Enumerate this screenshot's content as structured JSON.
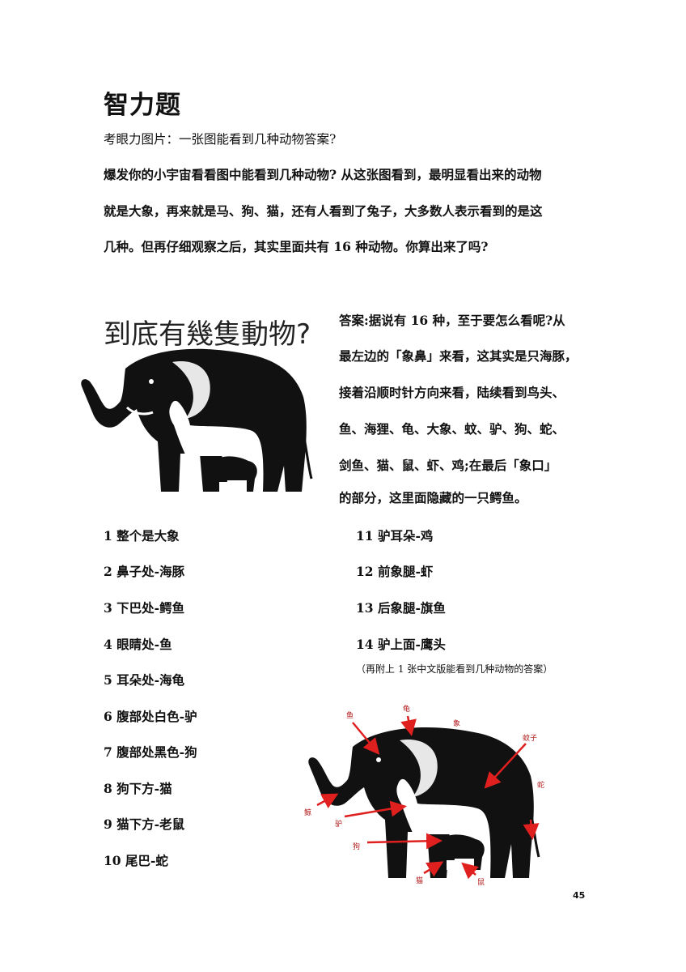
{
  "title": "智力题",
  "subtitle": "考眼力图片：一张图能看到几种动物答案?",
  "intro": [
    "爆发你的小宇宙看看图中能看到几种动物? 从这张图看到，最明显看出来的动物",
    "就是大象，再来就是马、狗、猫，还有人看到了兔子，大多数人表示看到的是这",
    "几种。但再仔细观察之后，其实里面共有 16 种动物。你算出来了吗?"
  ],
  "puzzle_image": {
    "caption": "到底有幾隻動物?"
  },
  "answer_paragraph": [
    "答案:据说有 16 种，至于要怎么看呢?从",
    "最左边的「象鼻」来看，这其实是只海豚，",
    "接着沿顺时针方向来看，陆续看到鸟头、",
    "鱼、海狸、龟、大象、蚊、驴、狗、蛇、",
    "剑鱼、猫、鼠、虾、鸡;在最后「象口」",
    "的部分，这里面隐藏的一只鳄鱼。"
  ],
  "list_left": [
    "1  整个是大象",
    "2  鼻子处-海豚",
    "3  下巴处-鳄鱼",
    "4  眼睛处-鱼",
    "5  耳朵处-海龟",
    "6  腹部处白色-驴",
    "7  腹部处黑色-狗",
    "8  狗下方-猫",
    "9  猫下方-老鼠",
    "10  尾巴-蛇"
  ],
  "list_right": [
    "11  驴耳朵-鸡",
    "12  前象腿-虾",
    "13  后象腿-旗鱼",
    "14  驴上面-鹰头"
  ],
  "note": "（再附上 1 张中文版能看到几种动物的答案）",
  "answer_image_labels": [
    "鱼",
    "龟",
    "象",
    "蚊子",
    "蛇",
    "鲸",
    "驴",
    "狗",
    "猫",
    "鼠"
  ],
  "page_number": "45",
  "colors": {
    "silhouette": "#111111",
    "arrow": "#e0201f",
    "label": "#b01818"
  }
}
